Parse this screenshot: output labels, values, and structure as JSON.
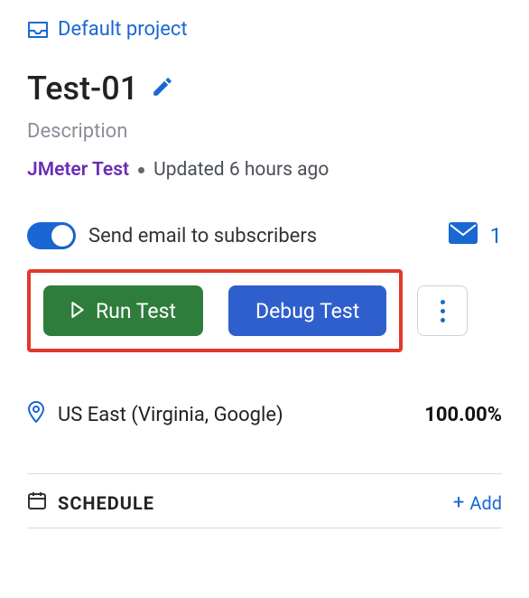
{
  "breadcrumb": {
    "project_label": "Default project"
  },
  "header": {
    "title": "Test-01",
    "description_placeholder": "Description",
    "test_type": "JMeter Test",
    "updated_text": "Updated 6 hours ago"
  },
  "email": {
    "toggle_on": true,
    "label": "Send email to subscribers",
    "subscribers_count": "1"
  },
  "actions": {
    "run_label": "Run Test",
    "debug_label": "Debug Test"
  },
  "location": {
    "name": "US East (Virginia, Google)",
    "percent": "100.00%"
  },
  "schedule": {
    "label": "SCHEDULE",
    "add_label": "Add"
  }
}
